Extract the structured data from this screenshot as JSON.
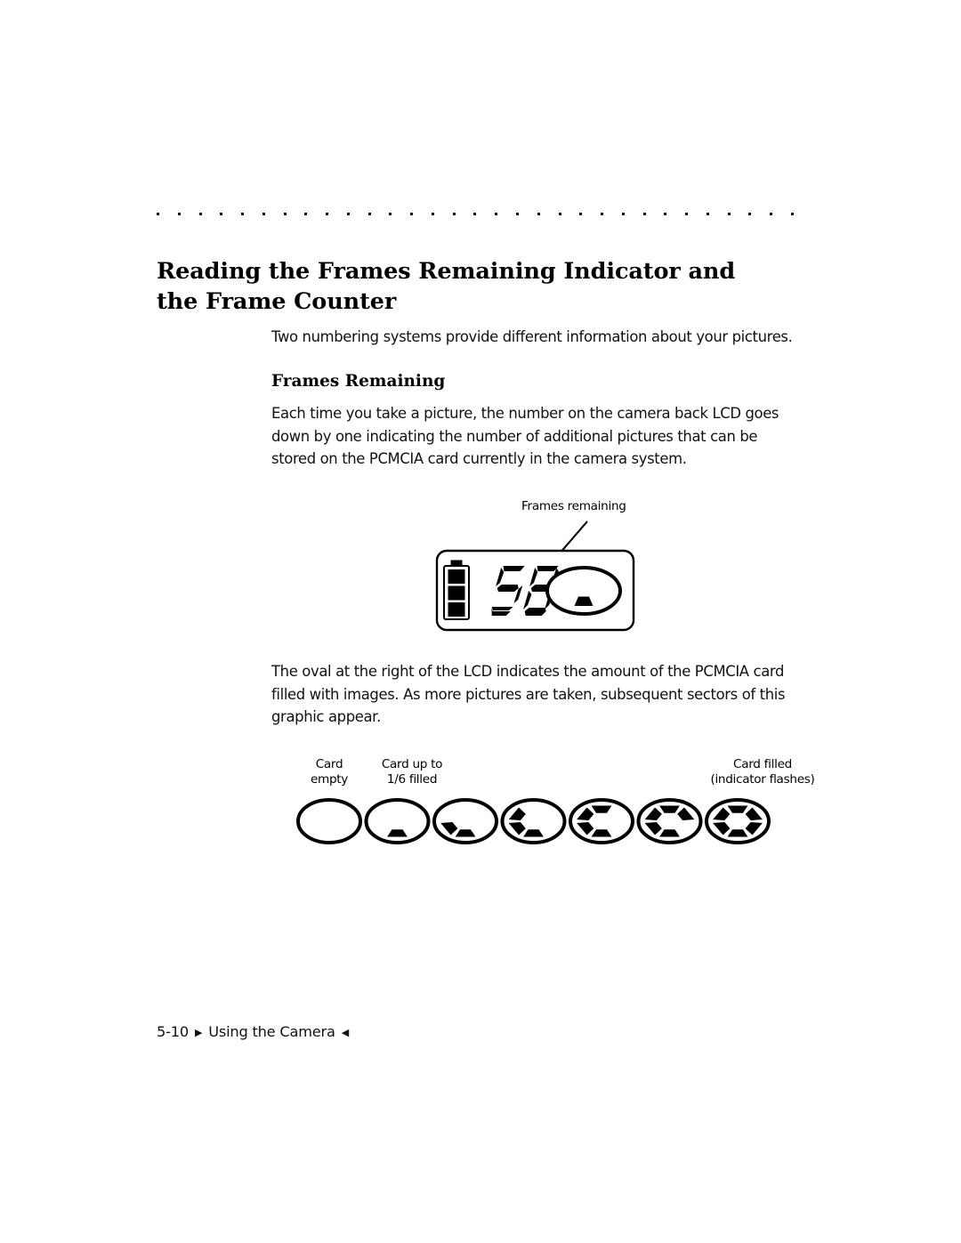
{
  "document": {
    "heading": {
      "line1": "Reading the Frames Remaining Indicator and",
      "line2": "the Frame Counter"
    },
    "intro_paragraph": {
      "lines": [
        "Two numbering systems provide different information about your pictures."
      ]
    },
    "subheading": "Frames Remaining",
    "frames_paragraph": {
      "lines": [
        "Each time you take a picture, the number on the camera back LCD goes",
        "down by one indicating the number of additional pictures that can be",
        "stored on the PCMCIA card currently in the camera system."
      ]
    },
    "oval_paragraph": {
      "lines": [
        "The oval at the right of the LCD indicates the amount of the PCMCIA card",
        "filled with images. As more pictures are taken, subsequent sectors of this",
        "graphic appear."
      ]
    }
  },
  "lcd_figure": {
    "callout_label": "Frames remaining",
    "frames_remaining_value": "58",
    "battery_segments_filled": 3,
    "battery_segments_total": 3,
    "card_sectors_filled": 1,
    "card_sectors_total": 6
  },
  "card_fill_figure": {
    "captions": {
      "empty": {
        "line1": "Card",
        "line2": "empty"
      },
      "one_sixth": {
        "line1": "Card up to",
        "line2": "1/6 filled"
      },
      "full": {
        "line1": "Card filled",
        "line2": "(indicator flashes)"
      }
    },
    "states": [
      {
        "label": "Card empty",
        "filled": 0
      },
      {
        "label": "Card up to 1/6 filled",
        "filled": 1
      },
      {
        "label": "Card 2/6 filled",
        "filled": 2
      },
      {
        "label": "Card 3/6 filled",
        "filled": 3
      },
      {
        "label": "Card 4/6 filled",
        "filled": 4
      },
      {
        "label": "Card 5/6 filled",
        "filled": 5
      },
      {
        "label": "Card filled (indicator flashes)",
        "filled": 6
      }
    ]
  },
  "footer": {
    "page_number": "5-10",
    "left_marker": "▶",
    "chapter_title": "Using the Camera",
    "right_marker": "◀"
  },
  "colors": {
    "text": "#111111",
    "ink": "#000000",
    "page_background": "#ffffff"
  }
}
